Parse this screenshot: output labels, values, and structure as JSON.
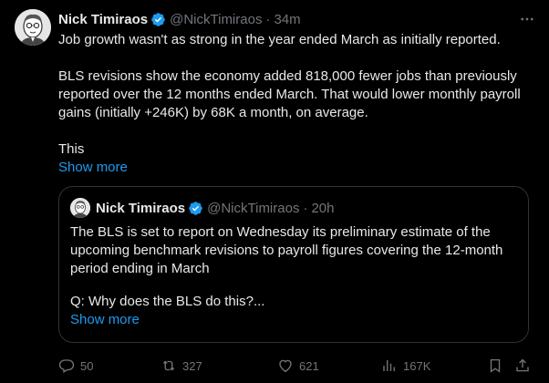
{
  "tweet": {
    "author": {
      "name": "Nick Timiraos",
      "handle": "@NickTimiraos",
      "verified": true
    },
    "separator": "·",
    "time": "34m",
    "body": [
      "Job growth wasn't as strong in the year ended March as initially reported.",
      "BLS revisions show the economy added 818,000 fewer jobs than previously reported over the 12 months ended March. That would lower monthly payroll gains (initially +246K) by 68K a month, on average.",
      "This"
    ],
    "show_more": "Show more"
  },
  "quote": {
    "author": {
      "name": "Nick Timiraos",
      "handle": "@NickTimiraos",
      "verified": true
    },
    "separator": "·",
    "time": "20h",
    "body": [
      "The BLS is set to report on Wednesday its preliminary estimate of the upcoming benchmark revisions to payroll figures covering the 12-month period ending in March",
      "Q: Why does the BLS do this?..."
    ],
    "show_more": "Show more"
  },
  "actions": {
    "replies": "50",
    "reposts": "327",
    "likes": "621",
    "views": "167K"
  },
  "icons": {
    "verified": "verified-badge-icon",
    "more": "more-dots-icon",
    "reply": "reply-icon",
    "repost": "repost-icon",
    "like": "heart-icon",
    "views": "views-chart-icon",
    "bookmark": "bookmark-icon",
    "share": "share-icon"
  },
  "colors": {
    "background": "#000000",
    "text": "#e7e9ea",
    "muted": "#71767b",
    "link": "#1d9bf0",
    "border": "#2f3336",
    "verified": "#1d9bf0"
  }
}
